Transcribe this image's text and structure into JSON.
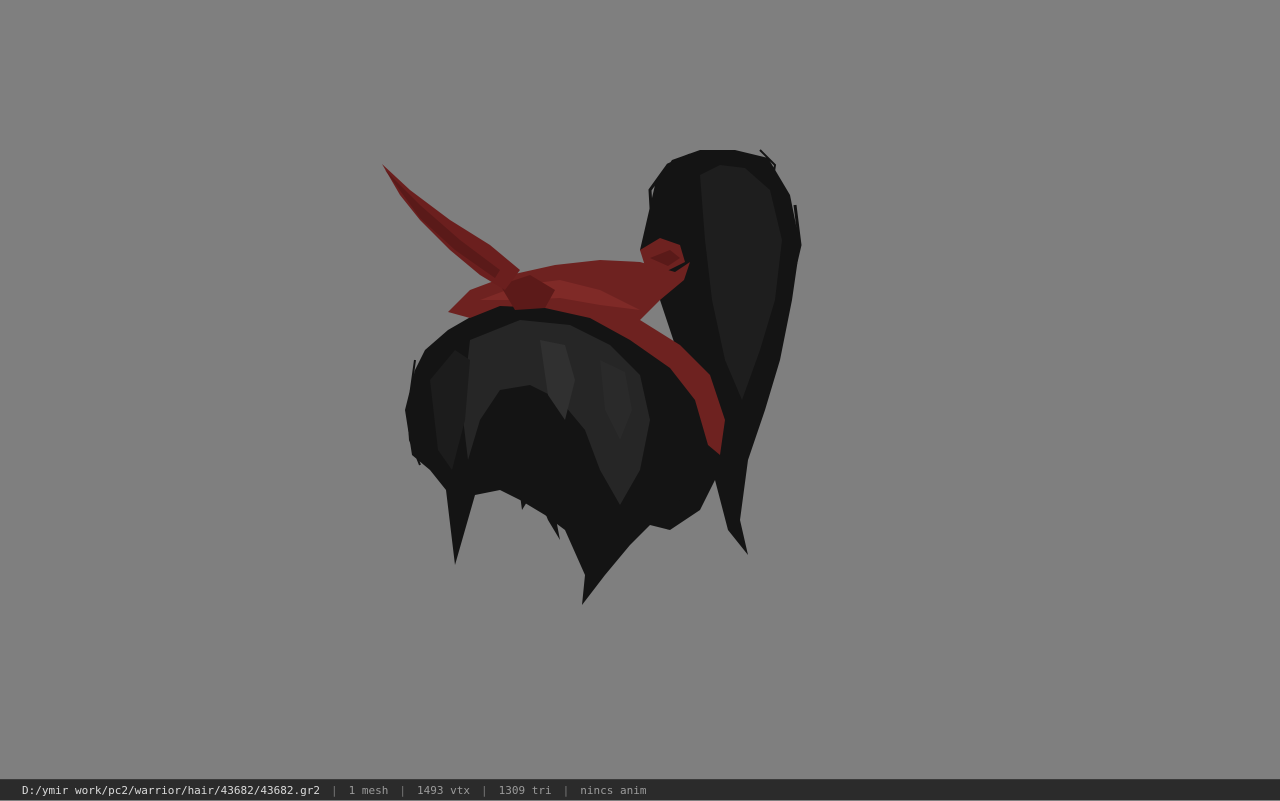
{
  "viewer": {
    "background_color": "#7f7f7f",
    "model": {
      "hair_color": "#141414",
      "bandana_color": "#6e2220"
    }
  },
  "status_bar": {
    "file_path": "D:/ymir work/pc2/warrior/hair/43682/43682.gr2",
    "mesh_count": "1 mesh",
    "vertex_count": "1493 vtx",
    "triangle_count": "1309 tri",
    "anim_status": "nincs anim",
    "separator": "|"
  }
}
